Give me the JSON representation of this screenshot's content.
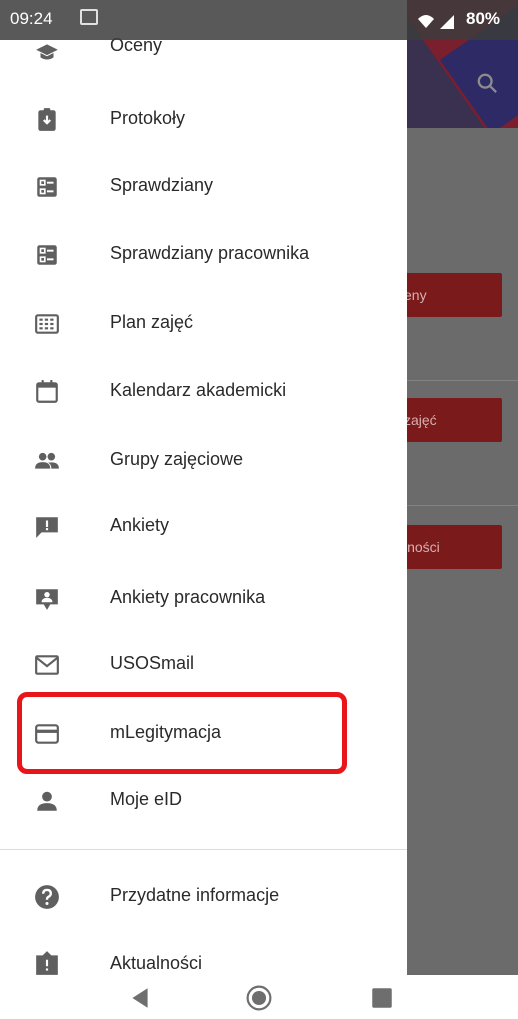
{
  "status_bar": {
    "time": "09:24",
    "battery": "80%"
  },
  "drawer": {
    "items": [
      {
        "label": "Oceny",
        "icon": "school-icon"
      },
      {
        "label": "Protokoły",
        "icon": "clipboard-download-icon"
      },
      {
        "label": "Sprawdziany",
        "icon": "checklist-icon"
      },
      {
        "label": "Sprawdziany pracownika",
        "icon": "checklist-icon"
      },
      {
        "label": "Plan zajęć",
        "icon": "timetable-icon"
      },
      {
        "label": "Kalendarz akademicki",
        "icon": "calendar-icon"
      },
      {
        "label": "Grupy zajęciowe",
        "icon": "people-icon"
      },
      {
        "label": "Ankiety",
        "icon": "feedback-icon"
      },
      {
        "label": "Ankiety pracownika",
        "icon": "person-feedback-icon"
      },
      {
        "label": "USOSmail",
        "icon": "mail-icon"
      },
      {
        "label": "mLegitymacja",
        "icon": "card-icon"
      },
      {
        "label": "Moje eID",
        "icon": "person-icon"
      },
      {
        "label": "Przydatne informacje",
        "icon": "help-icon"
      },
      {
        "label": "Aktualności",
        "icon": "news-icon"
      }
    ],
    "highlighted_item": "mLegitymacja",
    "highlight_color": "#e8161b"
  },
  "background_app": {
    "buttons": [
      "eny",
      "zajęć",
      "lności"
    ],
    "accent_color": "#7a1a1a"
  },
  "nav_bar": {
    "icons": [
      "back-icon",
      "home-icon",
      "recents-icon"
    ]
  }
}
